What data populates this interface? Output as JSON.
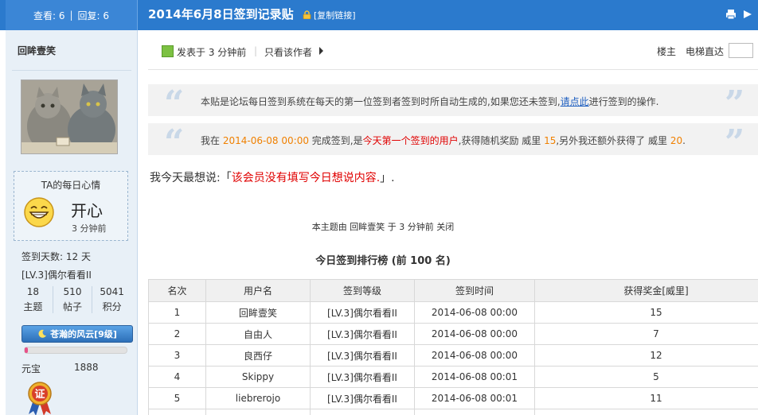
{
  "header": {
    "views_label": "查看: 6",
    "replies_label": "回复: 6",
    "separator": "|",
    "title": "2014年6月8日签到记录贴",
    "copy_link": "[复制链接]",
    "icons": [
      "lock-icon",
      "print-icon",
      "next-page-icon"
    ]
  },
  "sidebar": {
    "username": "回眸壹笑",
    "mood_title": "TA的每日心情",
    "mood": "开心",
    "mood_time": "3 分钟前",
    "sign_days": "签到天数: 12 天",
    "level": "[LV.3]偶尔看看II",
    "stats": [
      {
        "value": "18",
        "label": "主题"
      },
      {
        "value": "510",
        "label": "帖子"
      },
      {
        "value": "5041",
        "label": "积分"
      }
    ],
    "rank_badge": "苍瀚的风云[9级]",
    "rank_progress": 0.03,
    "ingot_label": "元宝",
    "ingot_value": "1888",
    "medal_char": "证"
  },
  "post": {
    "posted_at": "发表于 3 分钟前",
    "separator": "|",
    "only_author": "只看该作者",
    "floor": "楼主",
    "elevator": "电梯直达",
    "elevator_value": ""
  },
  "quotes": {
    "q1_before": "本贴是论坛每日签到系统在每天的第一位签到者签到时所自动生成的,如果您还未签到,",
    "q1_link": "请点此",
    "q1_after": "进行签到的操作.",
    "q2_prefix": "我在 ",
    "q2_date": "2014-06-08 00:00",
    "q2_mid1": " 完成签到,是",
    "q2_red": "今天第一个签到的用户",
    "q2_mid2": ",获得随机奖励 威里 ",
    "q2_reward1": "15",
    "q2_mid3": ",另外我还额外获得了 威里 ",
    "q2_reward2": "20",
    "q2_end": "."
  },
  "today_wish": {
    "prefix": "我今天最想说:「",
    "text": "该会员没有填写今日想说内容.",
    "suffix": "」."
  },
  "closed_note": "本主题由 回眸壹笑 于 3 分钟前 关闭",
  "ranking": {
    "title": "今日签到排行榜 (前 100 名)",
    "headers": [
      "名次",
      "用户名",
      "签到等级",
      "签到时间",
      "获得奖金[威里]"
    ],
    "rows": [
      [
        "1",
        "回眸壹笑",
        "[LV.3]偶尔看看II",
        "2014-06-08 00:00",
        "15"
      ],
      [
        "2",
        "自由人",
        "[LV.3]偶尔看看II",
        "2014-06-08 00:00",
        "7"
      ],
      [
        "3",
        "良西仔",
        "[LV.3]偶尔看看II",
        "2014-06-08 00:00",
        "12"
      ],
      [
        "4",
        "Skippy",
        "[LV.3]偶尔看看II",
        "2014-06-08 00:01",
        "5"
      ],
      [
        "5",
        "liebrerojo",
        "[LV.3]偶尔看看II",
        "2014-06-08 00:01",
        "11"
      ],
      [
        "",
        "",
        "",
        "",
        ""
      ]
    ]
  },
  "colors": {
    "header_blue": "#2b7acd",
    "sidebar_bg": "#e8f0f7",
    "link_blue": "#2060c0",
    "orange": "#f08000",
    "red": "#e00000"
  }
}
